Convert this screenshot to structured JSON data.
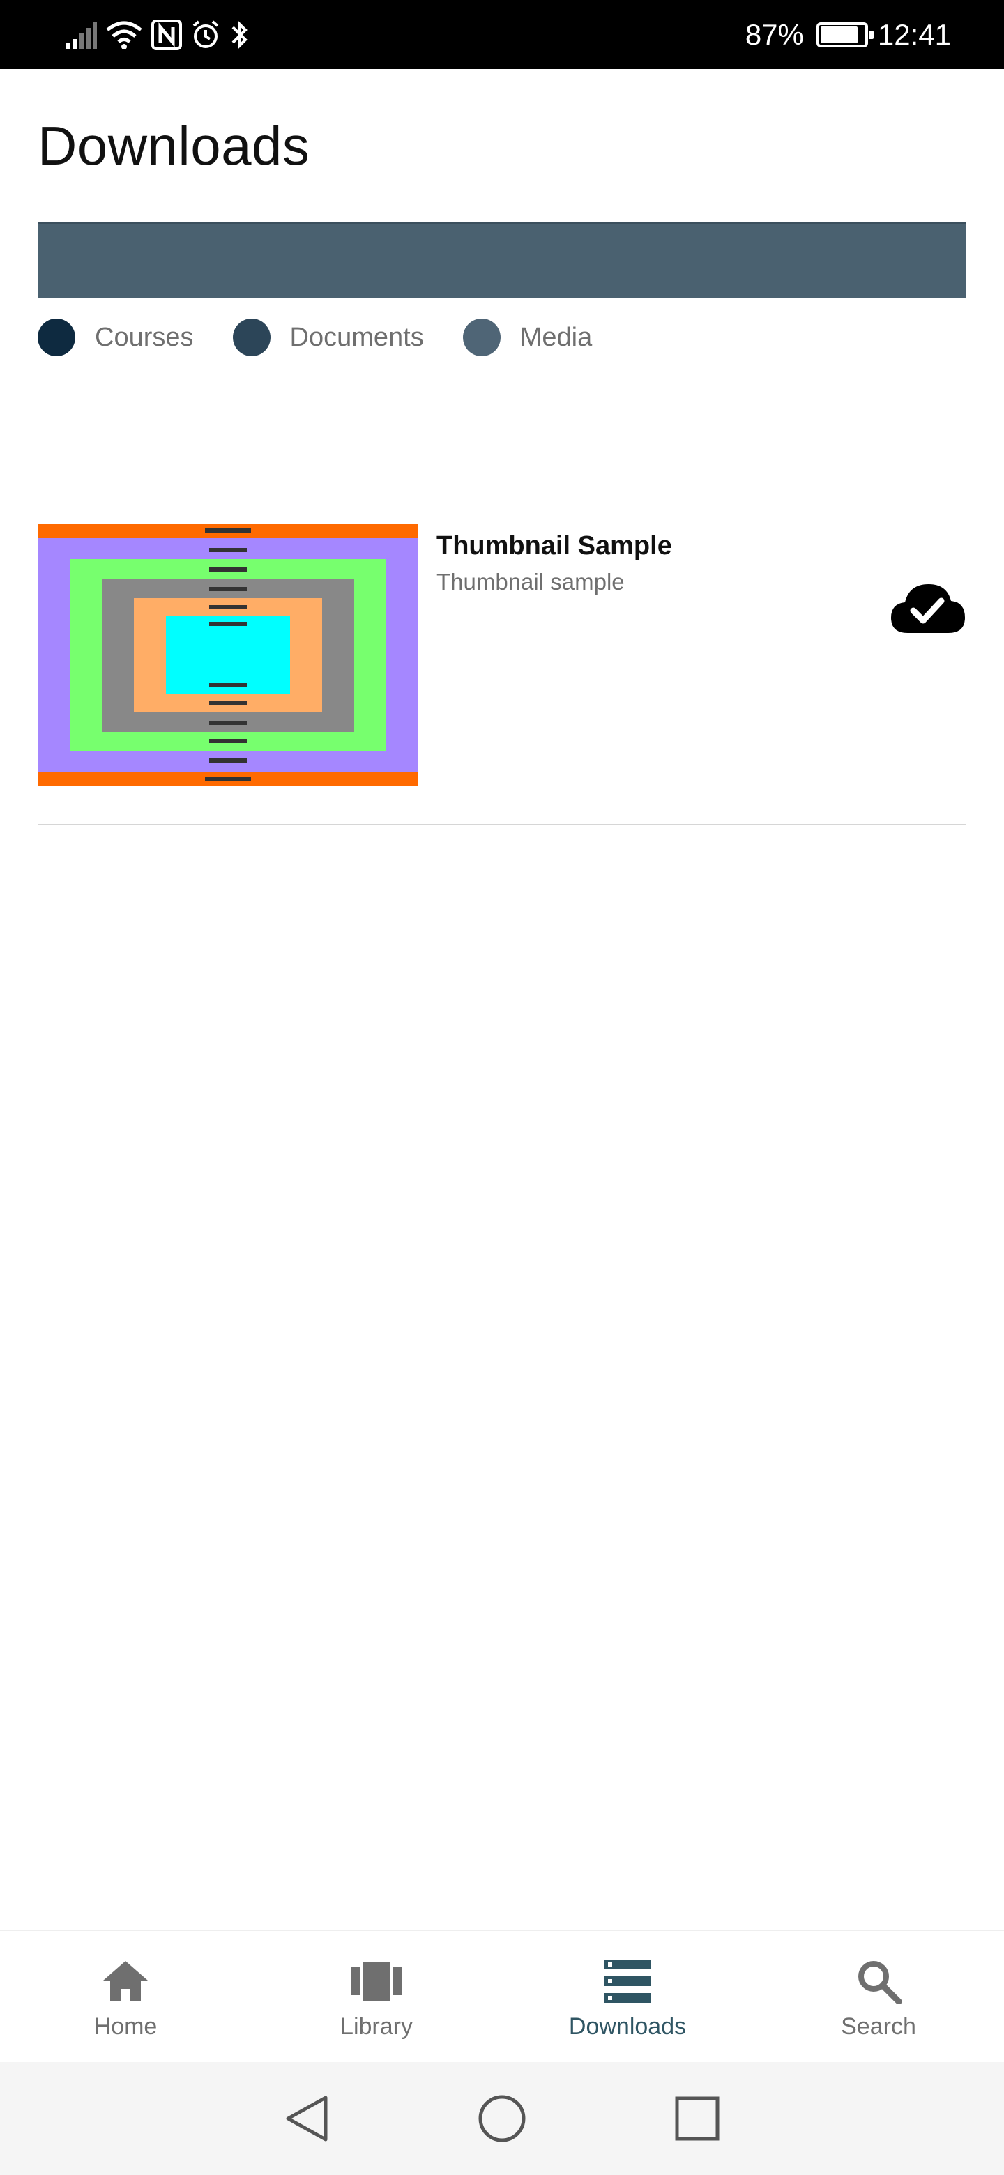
{
  "status_bar": {
    "battery_percent_text": "87%",
    "battery_level": 0.87,
    "time": "12:41"
  },
  "header": {
    "title": "Downloads"
  },
  "storage": {
    "bar_color": "#4a6170",
    "legend": [
      {
        "label": "Courses",
        "color": "#0e2a40"
      },
      {
        "label": "Documents",
        "color": "#2c4558"
      },
      {
        "label": "Media",
        "color": "#4f6576"
      }
    ]
  },
  "downloads": {
    "items": [
      {
        "title": "Thumbnail Sample",
        "subtitle": "Thumbnail sample",
        "status_icon": "cloud-check-icon"
      }
    ]
  },
  "bottom_nav": {
    "items": [
      {
        "label": "Home",
        "icon": "home-icon",
        "active": false
      },
      {
        "label": "Library",
        "icon": "library-icon",
        "active": false
      },
      {
        "label": "Downloads",
        "icon": "downloads-icon",
        "active": true
      },
      {
        "label": "Search",
        "icon": "search-icon",
        "active": false
      }
    ],
    "active_color": "#2f5563",
    "inactive_color": "#6f6f6f"
  },
  "system_nav": {
    "buttons": [
      "back-icon",
      "home-circle-icon",
      "recents-icon"
    ]
  }
}
